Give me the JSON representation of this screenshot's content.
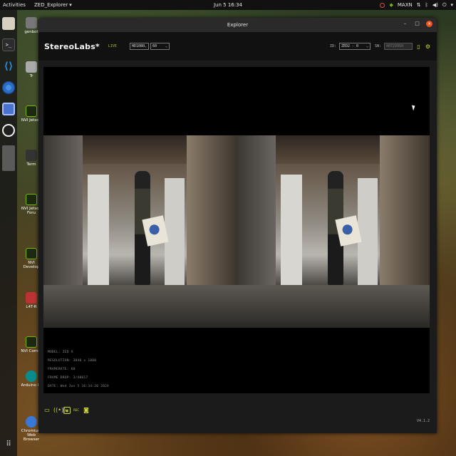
{
  "topbar": {
    "activities": "Activities",
    "app_menu": "ZED_Explorer",
    "app_menu_chevron": "▾",
    "clock": "Jun 5  16:34",
    "nvidia_label": "MAXN"
  },
  "desktop_icons": [
    {
      "label": "genbot",
      "icon": "home-folder-icon"
    },
    {
      "label": "Tr",
      "icon": "trash-icon"
    },
    {
      "label": "NVI Jetson",
      "icon": "nvidia-icon"
    },
    {
      "label": "Term",
      "icon": "terminal-icon"
    },
    {
      "label": "NVI Jetson Foru",
      "icon": "nvidia-icon"
    },
    {
      "label": "NVI Develop",
      "icon": "nvidia-icon"
    },
    {
      "label": "L4T-R",
      "icon": "document-icon"
    },
    {
      "label": "NVI Comm",
      "icon": "nvidia-icon"
    },
    {
      "label": "Arduino ID",
      "icon": "arduino-icon"
    },
    {
      "label": "Chromium Web Browser",
      "icon": "chromium-icon"
    }
  ],
  "window": {
    "title": "Explorer",
    "minimize": "–",
    "maximize": "□",
    "close": "×"
  },
  "header": {
    "brand": "StereoLabs*",
    "live_label": "LIVE",
    "resolution_value": "HD1080",
    "fps_value": "60",
    "id_label": "ID:",
    "id_value": "ZED2 - 0",
    "sn_label": "SN:",
    "sn_value": "40729950"
  },
  "info": {
    "model": "MODEL: ZED X",
    "resolution": "RESOLUTION: 3840 x 1080",
    "framerate": "FRAMERATE: 60",
    "frame_drop": "FRAME DROP: 3/40617",
    "date": "DATE: Wed Jun 5 16:34:20 2024"
  },
  "toolbar": {
    "version": "V4.1.2",
    "rec_label": "REC"
  },
  "colors": {
    "accent": "#c9d840",
    "ubuntu_orange": "#e95420",
    "nvidia_green": "#76b900"
  }
}
